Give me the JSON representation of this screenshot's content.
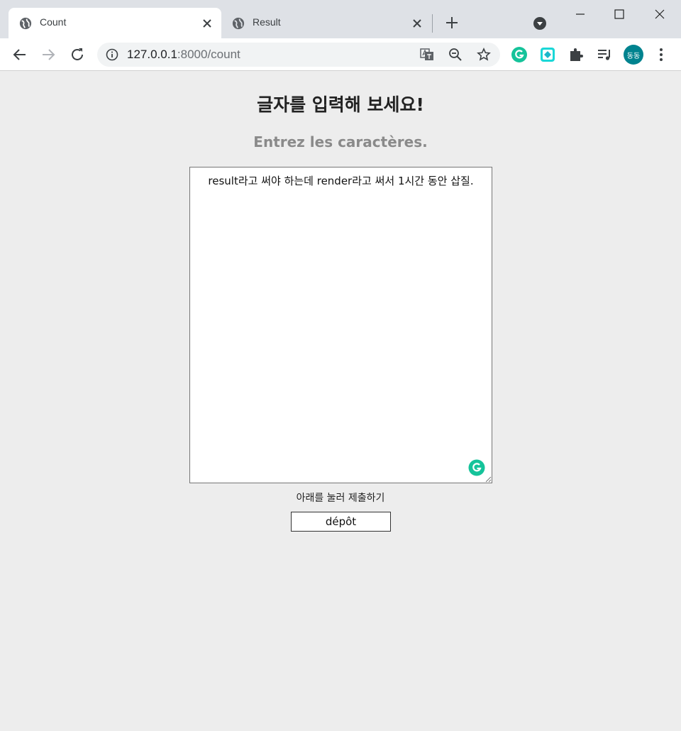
{
  "tabs": [
    {
      "title": "Count",
      "active": true
    },
    {
      "title": "Result",
      "active": false
    }
  ],
  "toolbar": {
    "url_host": "127.0.0.1",
    "url_path": ":8000/count",
    "avatar_label": "동동"
  },
  "page": {
    "heading": "글자를 입력해 보세요!",
    "subheading": "Entrez les caractères.",
    "textarea_value": "result라고 써야 하는데 render라고 써서 1시간 동안 삽질.",
    "hint": "아래를 눌러 제출하기",
    "submit_label": "dépôt"
  },
  "colors": {
    "tabstrip": "#dee1e6",
    "page_bg": "#ededed",
    "avatar": "#00838f",
    "grammarly": "#15c39a"
  }
}
